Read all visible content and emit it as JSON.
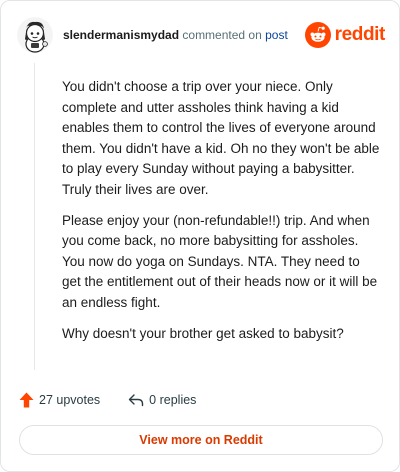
{
  "header": {
    "username": "slendermanismydad",
    "commented_on": "commented on",
    "post_link": "post",
    "brand": "reddit"
  },
  "comment": {
    "paragraphs": [
      "You didn't choose a trip over your niece. Only complete and utter assholes think having a kid enables them to control the lives of everyone around them. You didn't have a kid. Oh no they won't be able to play every Sunday without paying a babysitter. Truly their lives are over.",
      "Please enjoy your (non-refundable!!) trip. And when you come back, no more babysitting for assholes. You now do yoga on Sundays. NTA. They need to get the entitlement out of their heads now or it will be an endless fight.",
      "Why doesn't your brother get asked to babysit?"
    ]
  },
  "footer": {
    "upvotes": "27 upvotes",
    "replies": "0 replies"
  },
  "view_more": "View more on Reddit",
  "icons": {
    "avatar": "snoo-avatar-icon",
    "brand": "reddit-logo-icon",
    "upvote": "upvote-arrow-icon",
    "reply": "reply-arrow-icon"
  },
  "colors": {
    "brand": "#ff4500",
    "upvote": "#ff4500",
    "link": "#0a449b",
    "view_more_text": "#d93a00"
  }
}
